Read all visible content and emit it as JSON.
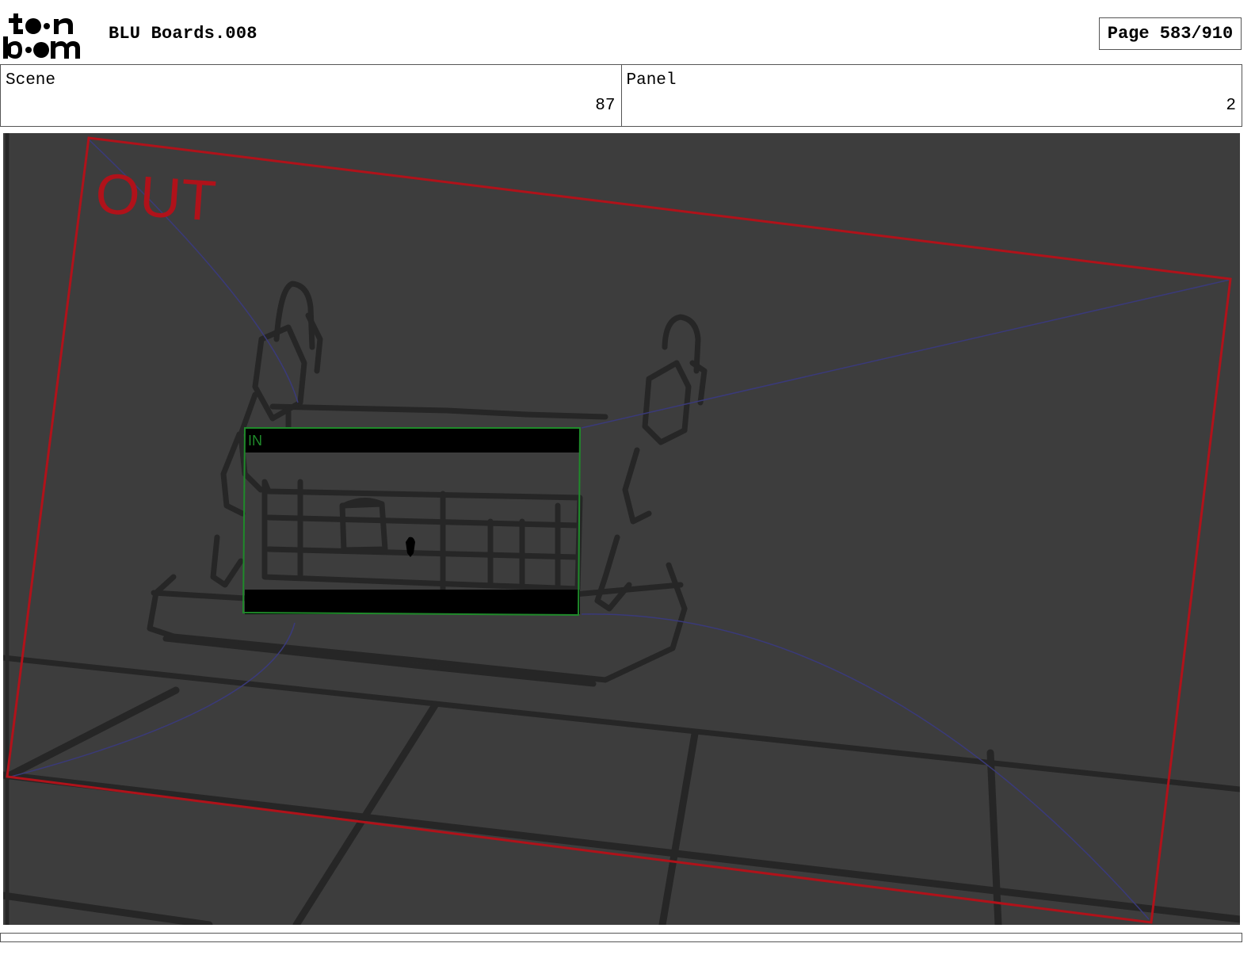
{
  "header": {
    "logo_text": "toonboom",
    "title": "BLU Boards.008",
    "page_label": "Page 583/910"
  },
  "info": {
    "scene_label": "Scene",
    "scene_value": "87",
    "panel_label": "Panel",
    "panel_value": "2"
  },
  "frame": {
    "out_label": "OUT",
    "in_label": "IN",
    "colors": {
      "out_frame": "#b0121a",
      "in_frame": "#1f8a2a",
      "camera_path": "#3a3a7a",
      "background": "#3d3d3d",
      "sketch": "#262626"
    }
  }
}
